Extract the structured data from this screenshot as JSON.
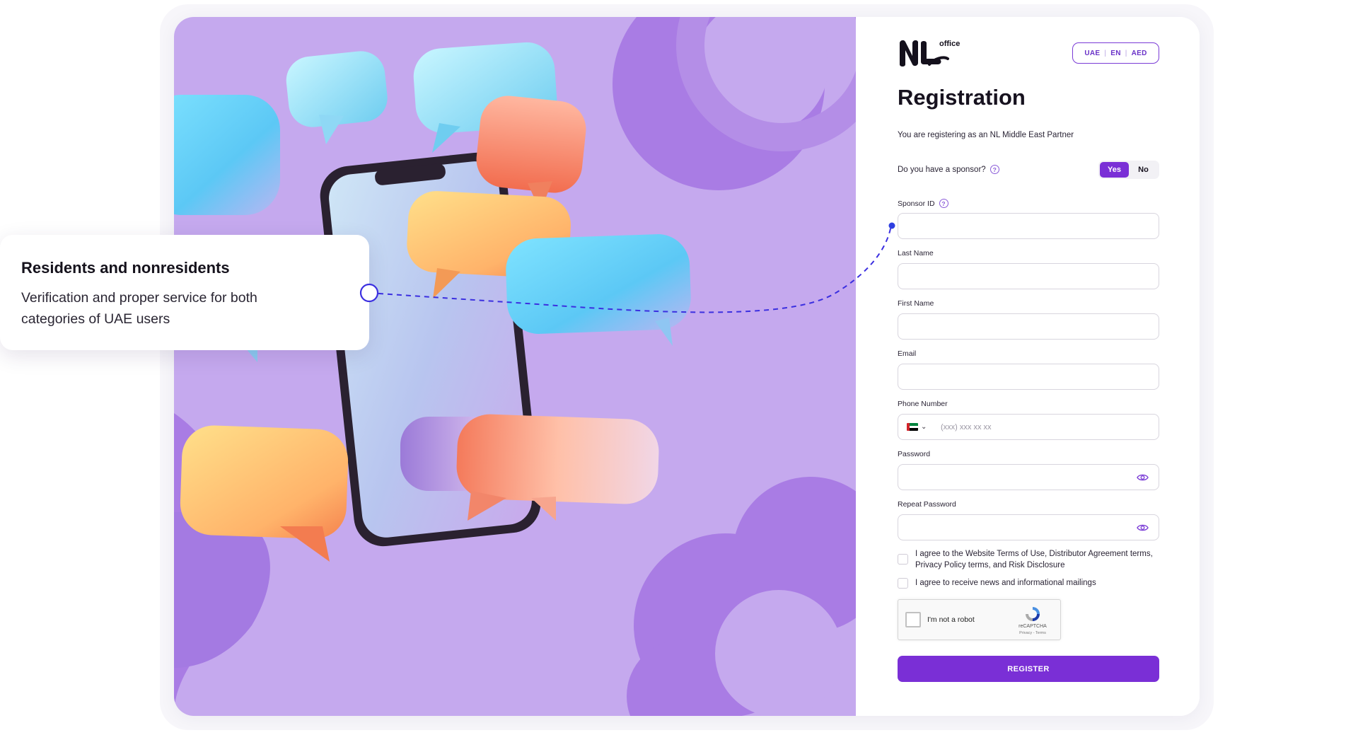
{
  "callout": {
    "title": "Residents and nonresidents",
    "body": "Verification and proper service for both categories of UAE users"
  },
  "header": {
    "logo_text": "office",
    "locale": {
      "country": "UAE",
      "language": "EN",
      "currency": "AED"
    }
  },
  "form": {
    "title": "Registration",
    "subtitle": "You are registering as an NL Middle East Partner",
    "sponsor_question": "Do you have a sponsor?",
    "sponsor_toggle": {
      "yes": "Yes",
      "no": "No",
      "selected": "Yes"
    },
    "fields": {
      "sponsor_id": {
        "label": "Sponsor ID",
        "value": ""
      },
      "last_name": {
        "label": "Last Name",
        "value": ""
      },
      "first_name": {
        "label": "First Name",
        "value": ""
      },
      "email": {
        "label": "Email",
        "value": ""
      },
      "phone": {
        "label": "Phone Number",
        "placeholder": "(xxx) xxx xx xx",
        "country": "UAE"
      },
      "password": {
        "label": "Password",
        "value": ""
      },
      "repeat_password": {
        "label": "Repeat Password",
        "value": ""
      }
    },
    "agreements": {
      "terms_line1": "I agree to the Website Terms of Use, Distributor Agreement terms,",
      "terms_line2": "Privacy Policy terms, and Risk Disclosure",
      "news": "I agree to receive news and informational mailings"
    },
    "recaptcha": {
      "label": "I'm not a robot",
      "brand": "reCAPTCHA",
      "terms": "Privacy - Terms"
    },
    "submit_label": "REGISTER"
  },
  "colors": {
    "accent": "#7a2fd6",
    "hero_bg": "#c5a9ee",
    "connector": "#3b2fe0"
  }
}
